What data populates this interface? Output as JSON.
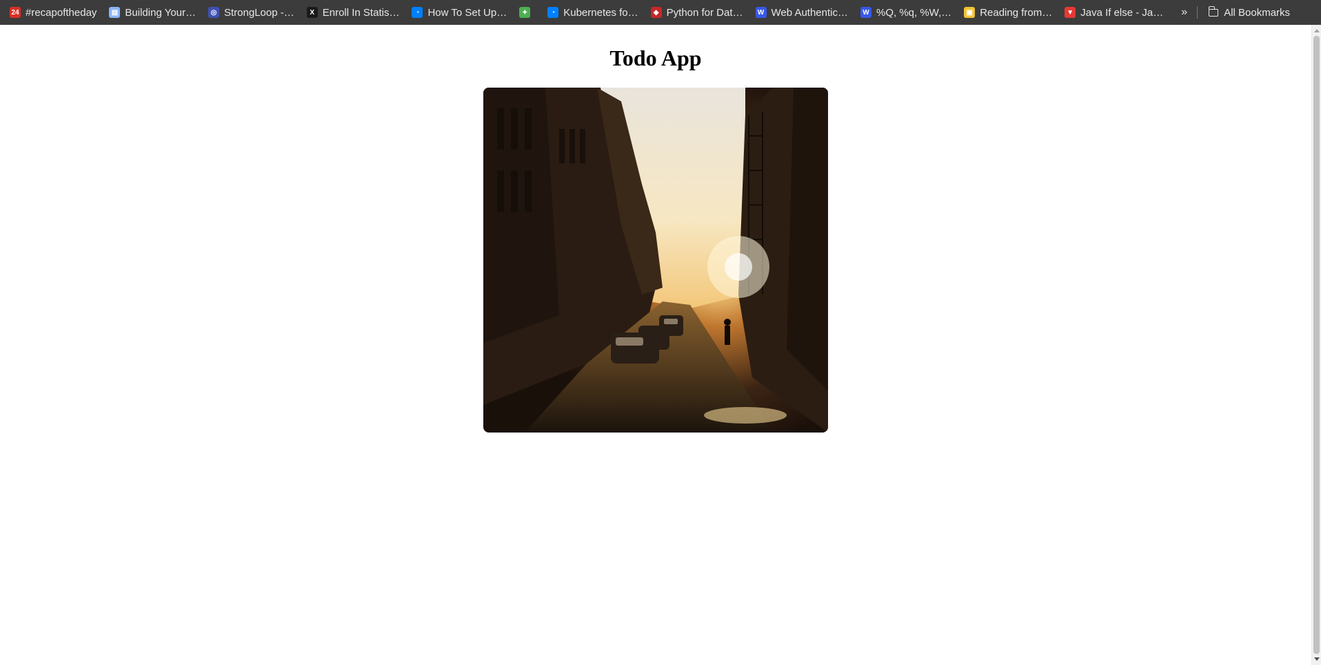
{
  "bookmarks": [
    {
      "label": "#recapoftheday",
      "icon": "news-badge-icon",
      "color": "#d93025"
    },
    {
      "label": "Building Your…",
      "icon": "document-icon",
      "color": "#8ab4f8"
    },
    {
      "label": "StrongLoop -…",
      "icon": "globe-icon",
      "color": "#3f51b5"
    },
    {
      "label": "Enroll In Statis…",
      "icon": "x-icon",
      "color": "#1a1a1a"
    },
    {
      "label": "How To Set Up…",
      "icon": "digitalocean-icon",
      "color": "#0080ff"
    },
    {
      "label": "",
      "icon": "pinwheel-icon",
      "color": "#4caf50"
    },
    {
      "label": "Kubernetes fo…",
      "icon": "digitalocean-icon",
      "color": "#0080ff"
    },
    {
      "label": "Python for Dat…",
      "icon": "shield-icon",
      "color": "#c62828"
    },
    {
      "label": "Web Authentic…",
      "icon": "wordpress-icon",
      "color": "#3858e9"
    },
    {
      "label": "%Q, %q, %W,…",
      "icon": "wordpress-icon",
      "color": "#3858e9"
    },
    {
      "label": "Reading from…",
      "icon": "photo-icon",
      "color": "#f2c230"
    },
    {
      "label": "Java If else - Ja…",
      "icon": "triangle-icon",
      "color": "#e53935"
    }
  ],
  "overflow_label": "»",
  "all_bookmarks_label": "All Bookmarks",
  "page": {
    "title": "Todo App",
    "image_alt": "sunlit city street"
  }
}
